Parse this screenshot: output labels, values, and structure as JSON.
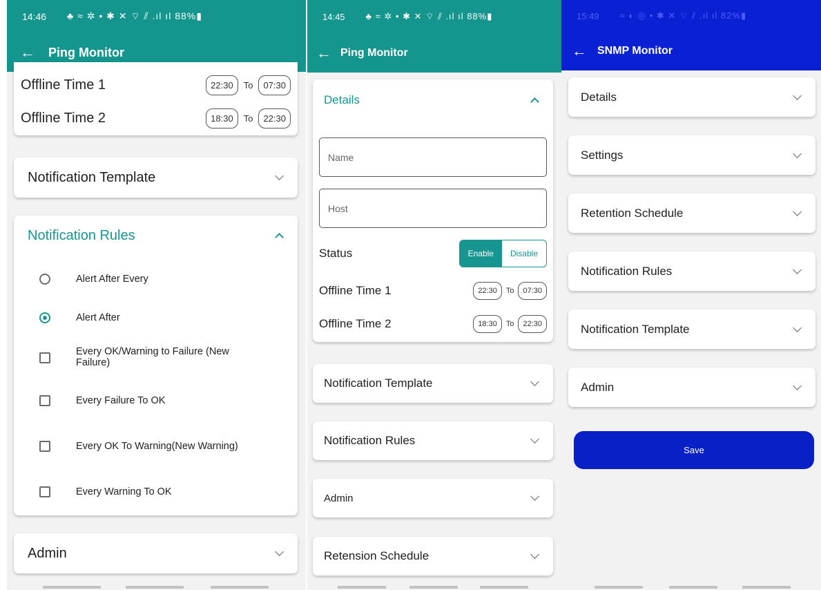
{
  "screen1": {
    "status_time": "14:46",
    "status_icons": "♣ ≈ ✲ •        ✱ ✕ ⌔ ⫽ .ıl ıl 88%▮",
    "title": "Ping Monitor",
    "offline_time_1": {
      "label": "Offline Time 1",
      "from": "22:30",
      "to_label": "To",
      "to": "07:30"
    },
    "offline_time_2": {
      "label": "Offline Time 2",
      "from": "18:30",
      "to_label": "To",
      "to": "22:30"
    },
    "notification_template": "Notification Template",
    "notification_rules": {
      "title": "Notification Rules",
      "options": [
        {
          "label": "Alert After Every",
          "type": "radio",
          "checked": false
        },
        {
          "label": "Alert After",
          "type": "radio",
          "checked": true
        },
        {
          "label": "Every OK/Warning to Failure (New Failure)",
          "type": "checkbox",
          "checked": false
        },
        {
          "label": "Every Failure To OK",
          "type": "checkbox",
          "checked": false
        },
        {
          "label": "Every OK To Warning(New Warning)",
          "type": "checkbox",
          "checked": false
        },
        {
          "label": "Every Warning To OK",
          "type": "checkbox",
          "checked": false
        }
      ]
    },
    "admin": "Admin"
  },
  "screen2": {
    "status_time": "14:45",
    "status_icons": "♣ ≈ ✲ •     ✱ ✕ ⌔ ⫽ .ıl ıl 88%▮",
    "title": "Ping Monitor",
    "details": "Details",
    "name_placeholder": "Name",
    "host_placeholder": "Host",
    "status_label": "Status",
    "enable": "Enable",
    "disable": "Disable",
    "offline_time_1": {
      "label": "Offline Time 1",
      "from": "22:30",
      "to_label": "To",
      "to": "07:30"
    },
    "offline_time_2": {
      "label": "Offline Time 2",
      "from": "18:30",
      "to_label": "To",
      "to": "22:30"
    },
    "notification_template": "Notification Template",
    "notification_rules": "Notification Rules",
    "admin": "Admin",
    "retension_schedule": "Retension Schedule"
  },
  "screen3": {
    "status_time": "15:49",
    "status_icons": "≈ ◐ ◎ •    ✱ ✕ ⌔ ⫽ .ıl ıl 82%▮",
    "title": "SNMP Monitor",
    "sections": [
      "Details",
      "Settings",
      "Retention Schedule",
      "Notification Rules",
      "Notification Template",
      "Admin"
    ],
    "save": "Save"
  },
  "colors": {
    "teal": "#14958d",
    "blue": "#0a20d3"
  }
}
